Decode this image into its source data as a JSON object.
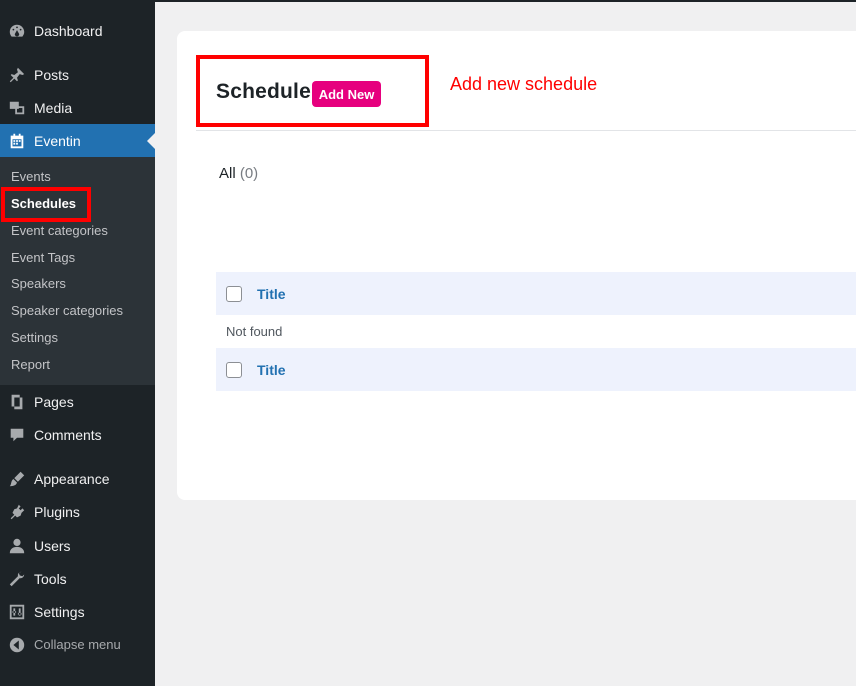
{
  "sidebar": {
    "items": [
      {
        "label": "Dashboard",
        "icon": "dashboard-icon"
      },
      {
        "label": "Posts",
        "icon": "pin-icon"
      },
      {
        "label": "Media",
        "icon": "media-icon"
      },
      {
        "label": "Eventin",
        "icon": "calendar-icon"
      },
      {
        "label": "Pages",
        "icon": "pages-icon"
      },
      {
        "label": "Comments",
        "icon": "comment-icon"
      },
      {
        "label": "Appearance",
        "icon": "brush-icon"
      },
      {
        "label": "Plugins",
        "icon": "plugin-icon"
      },
      {
        "label": "Users",
        "icon": "user-icon"
      },
      {
        "label": "Tools",
        "icon": "wrench-icon"
      },
      {
        "label": "Settings",
        "icon": "settings-icon"
      }
    ],
    "collapse_label": "Collapse menu",
    "submenu": [
      "Events",
      "Schedules",
      "Event categories",
      "Event Tags",
      "Speakers",
      "Speaker categories",
      "Settings",
      "Report"
    ]
  },
  "main": {
    "title": "Schedule",
    "add_new_label": "Add New",
    "annotation": "Add new schedule",
    "filter": {
      "label": "All",
      "count": "(0)"
    },
    "table": {
      "column_title": "Title",
      "empty_message": "Not found"
    }
  },
  "colors": {
    "sidebar_bg": "#1d2327",
    "active_bg": "#2271b1",
    "accent_button": "#e6007e",
    "annotation": "#ff0000"
  }
}
